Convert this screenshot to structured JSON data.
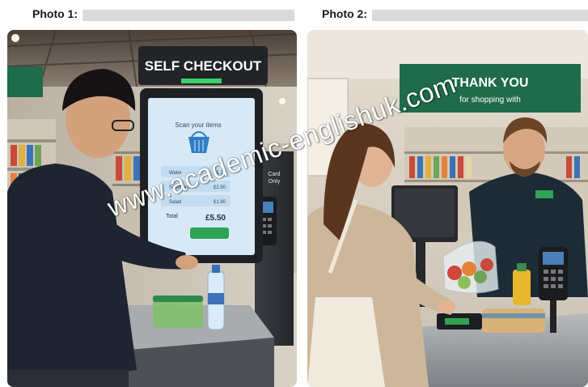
{
  "photo1": {
    "caption": "Photo 1:",
    "sign": "SELF CHECKOUT",
    "screen": {
      "title": "Scan your items",
      "items": [
        {
          "name": "Water",
          "price": "£1.20"
        },
        {
          "name": "Sandwich",
          "price": "£2.50"
        },
        {
          "name": "Salad",
          "price": "£1.80"
        }
      ],
      "total_label": "Total",
      "total_value": "£5.50"
    },
    "card_sign": "Card Only"
  },
  "photo2": {
    "caption": "Photo 2:",
    "banner_line1": "THANK YOU",
    "banner_line2": "for shopping with"
  },
  "watermark": "www.academic-englishuk.com",
  "colors": {
    "store_green": "#1f6b4a",
    "screen_blue": "#d7e9f7",
    "watermark": "#ffffff"
  }
}
